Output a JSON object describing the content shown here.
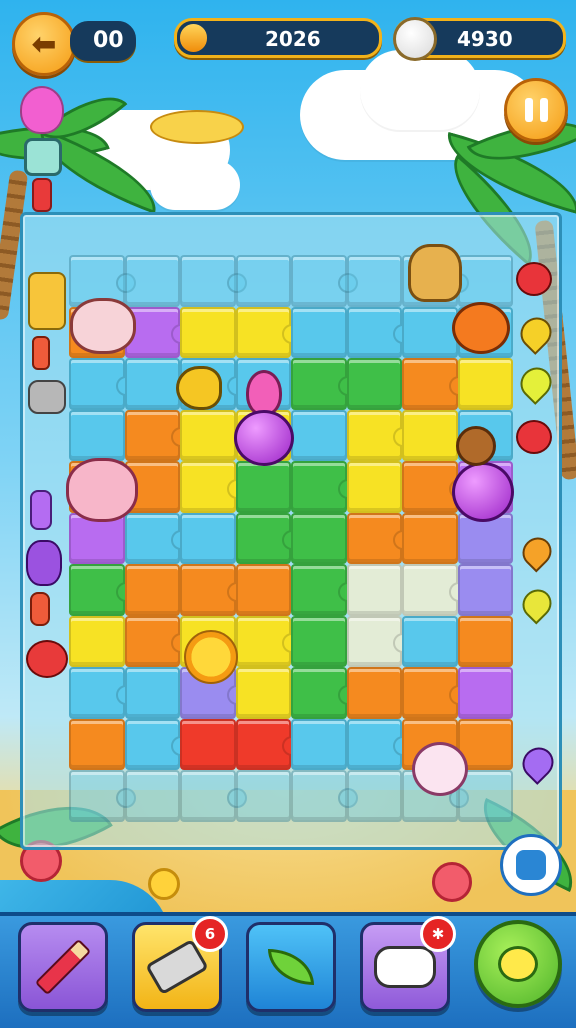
{
  "hud": {
    "moves": "00",
    "progress_value": "2026",
    "progress_fraction": 0.14,
    "coins": "4930"
  },
  "toolbar": {
    "badge_hint": "6",
    "badge_controller": "✱"
  },
  "colors": {
    "accent": "#f59b12",
    "board_border": "#2d8fb8",
    "toolbar": "#2a86d4"
  },
  "icons": [
    "back-arrow-icon",
    "progress-fill",
    "coin-icon",
    "pause-icon",
    "pencil-icon",
    "tools-icon",
    "leaf-icon",
    "controller-icon",
    "chat-icon",
    "shield-face-icon"
  ]
}
